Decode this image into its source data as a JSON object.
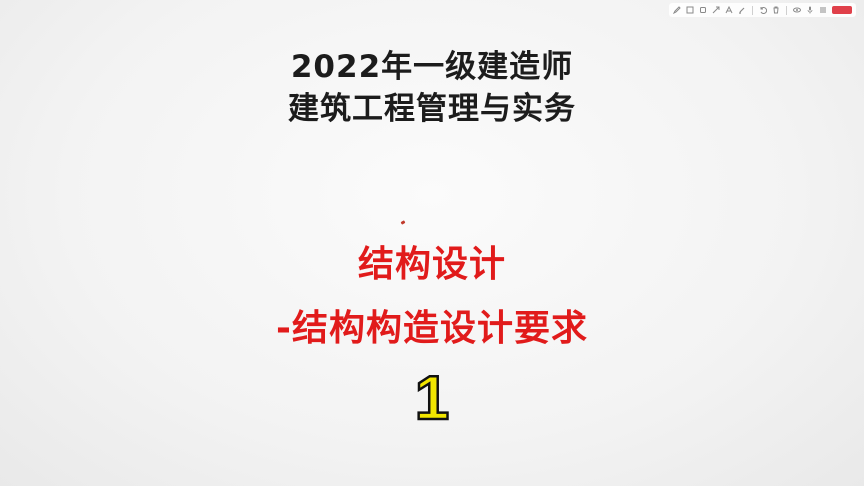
{
  "slide": {
    "title_line1": "2022年一级建造师",
    "title_line2": "建筑工程管理与实务",
    "topic": "结构设计",
    "subtopic": "-结构构造设计要求",
    "episode": "1"
  },
  "toolbar": {
    "tools": [
      "pen-icon",
      "square-icon",
      "rectangle-icon",
      "arrow-icon",
      "text-icon",
      "highlighter-icon",
      "undo-icon",
      "trash-icon",
      "eye-icon",
      "microphone-icon",
      "settings-icon",
      "record-button"
    ]
  },
  "colors": {
    "title": "#1c1c1c",
    "topic": "#e11b1b",
    "episode_fill": "#f2e600",
    "episode_stroke": "#111111",
    "record": "#e0404a"
  }
}
